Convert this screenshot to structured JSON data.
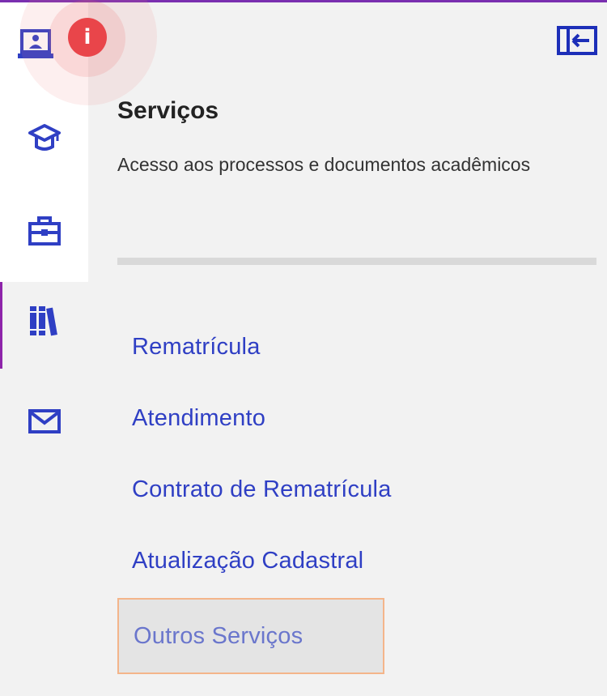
{
  "colors": {
    "accent": "#2f3fc4",
    "active_indicator": "#8e24aa",
    "badge": "#e9454a",
    "hover_border": "#f4b58a"
  },
  "rail": {
    "items": [
      {
        "name": "computer",
        "icon": "laptop-user-icon"
      },
      {
        "name": "academic",
        "icon": "graduation-cap-icon"
      },
      {
        "name": "work",
        "icon": "briefcase-icon"
      },
      {
        "name": "library",
        "icon": "books-icon",
        "active": true
      },
      {
        "name": "messages",
        "icon": "envelope-icon"
      }
    ],
    "badge_symbol": "i"
  },
  "panel": {
    "title": "Serviços",
    "description": "Acesso aos processos e documentos acadêmicos",
    "collapse_icon": "collapse-left-icon",
    "menu": [
      {
        "label": "Rematrícula"
      },
      {
        "label": "Atendimento"
      },
      {
        "label": "Contrato de Rematrícula"
      },
      {
        "label": "Atualização Cadastral"
      },
      {
        "label": "Outros Serviços",
        "hovered": true
      }
    ]
  }
}
